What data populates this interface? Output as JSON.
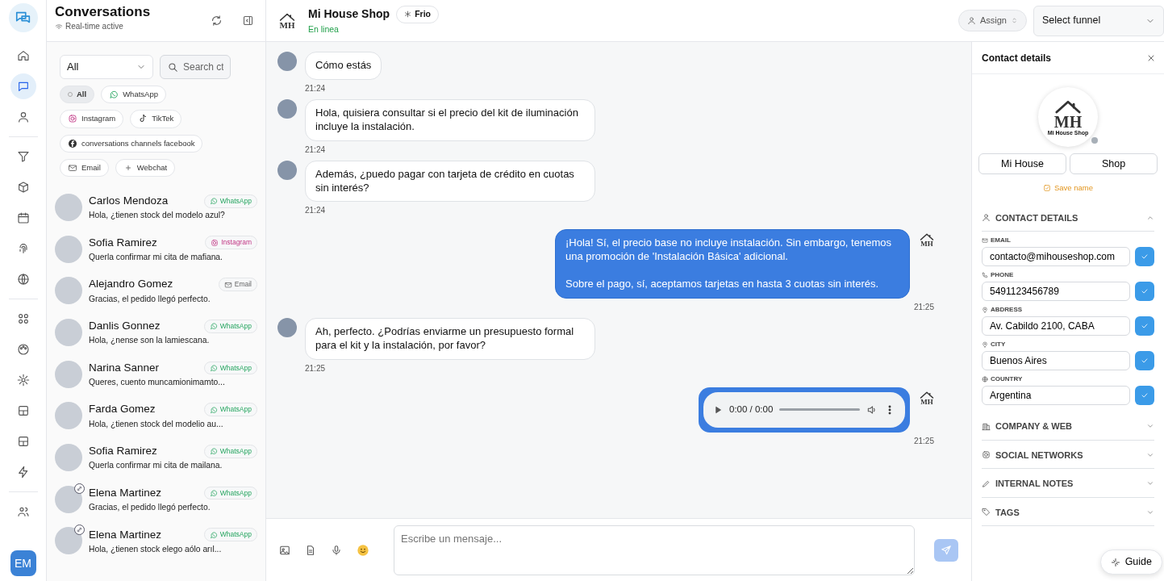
{
  "rail": {
    "groups": [
      [
        {
          "kind": "home",
          "selected": false
        },
        {
          "kind": "chat",
          "selected": true
        },
        {
          "kind": "user",
          "selected": false
        }
      ],
      [
        {
          "kind": "filter",
          "selected": false
        },
        {
          "kind": "box",
          "selected": false
        },
        {
          "kind": "calendar",
          "selected": false
        },
        {
          "kind": "fingerprint",
          "selected": false
        },
        {
          "kind": "globe",
          "selected": false
        }
      ],
      [
        {
          "kind": "apps",
          "selected": false
        },
        {
          "kind": "palette",
          "selected": false
        },
        {
          "kind": "gear",
          "selected": false
        },
        {
          "kind": "layout",
          "selected": false
        },
        {
          "kind": "layout",
          "selected": false
        },
        {
          "kind": "bolt",
          "selected": false
        }
      ],
      [
        {
          "kind": "users",
          "selected": false
        }
      ]
    ],
    "user_initials": "EM"
  },
  "conversations": {
    "title": "Conversations",
    "status": "Real-time active",
    "filter_value": "All",
    "search_placeholder": "Search ct",
    "channels": [
      {
        "kind": "all",
        "label": "All",
        "selected": true
      },
      {
        "kind": "whatsapp",
        "label": "WhatsApp",
        "selected": false
      },
      {
        "kind": "instagram",
        "label": "Instagram",
        "selected": false
      },
      {
        "kind": "tiktok",
        "label": "TikTek",
        "selected": false
      },
      {
        "kind": "facebook",
        "label": "conversations channels facebook",
        "selected": false
      },
      {
        "kind": "email",
        "label": "Email",
        "selected": false
      },
      {
        "kind": "webchat",
        "label": "Webchat",
        "selected": false
      }
    ],
    "items": [
      {
        "name": "Carlos Mendoza",
        "channel": {
          "kind": "whatsapp",
          "label": "WhatsApp"
        },
        "preview": "Hola, ¿tienen stock del modelo azul?",
        "badge": false
      },
      {
        "name": "Sofia Ramirez",
        "channel": {
          "kind": "instagram",
          "label": "Instagram"
        },
        "preview": "Querla confirmar mi cita de mafiana.",
        "badge": false
      },
      {
        "name": "Alejandro Gomez",
        "channel": {
          "kind": "email",
          "label": "Email"
        },
        "preview": "Gracias, el pedido llegó perfecto.",
        "badge": false
      },
      {
        "name": "Danlis Gonnez",
        "channel": {
          "kind": "whatsapp",
          "label": "WhatsApp"
        },
        "preview": "Hola, ¿nense son la lamiescana.",
        "badge": false
      },
      {
        "name": "Narina Sanner",
        "channel": {
          "kind": "whatsapp",
          "label": "WhatsApp"
        },
        "preview": "Queres, cuento muncamionimamto...",
        "badge": false
      },
      {
        "name": "Farda Gomez",
        "channel": {
          "kind": "whatsapp",
          "label": "WhatsApp"
        },
        "preview": "Hola, ¿tienen stock del modelio au...",
        "badge": false
      },
      {
        "name": "Sofia Ramirez",
        "channel": {
          "kind": "whatsapp",
          "label": "WhatsApp"
        },
        "preview": "Querla confirmar mi cita de mailana.",
        "badge": false
      },
      {
        "name": "Elena Martinez",
        "channel": {
          "kind": "whatsapp",
          "label": "WhatsApp"
        },
        "preview": "Gracias, el pedido llegó perfecto.",
        "badge": true
      },
      {
        "name": "Elena Martinez",
        "channel": {
          "kind": "whatsapp",
          "label": "WhatsApp"
        },
        "preview": "Hola, ¿tienen stock elego aólo arıl...",
        "badge": true
      }
    ]
  },
  "chat": {
    "header": {
      "logo_text": "MH",
      "name": "Mi House Shop",
      "tag": "Frio",
      "status": "En linea"
    },
    "assign_label": "Assign",
    "funnel_value": "Select funnel",
    "messages": [
      {
        "outgoing": false,
        "kind": "text",
        "paragraphs": [
          "Cómo estás"
        ],
        "time": "21:24"
      },
      {
        "outgoing": false,
        "kind": "text",
        "paragraphs": [
          "Hola, quisiera consultar si el precio del kit de iluminación incluye la instalación."
        ],
        "time": "21:24"
      },
      {
        "outgoing": false,
        "kind": "text",
        "paragraphs": [
          "Además, ¿puedo pagar con tarjeta de crédito en cuotas sin interés?"
        ],
        "time": "21:24"
      },
      {
        "outgoing": true,
        "kind": "text",
        "paragraphs": [
          "¡Hola! Sí, el precio base no incluye instalación. Sin embargo, tenemos una promoción de 'Instalación Básica' adicional.",
          "Sobre el pago, sí, aceptamos tarjetas en hasta 3 cuotas sin interés."
        ],
        "time": "21:25",
        "avatar_text": "MH"
      },
      {
        "outgoing": false,
        "kind": "text",
        "paragraphs": [
          "Ah, perfecto. ¿Podrías enviarme un presupuesto formal para el kit y la instalación, por favor?"
        ],
        "time": "21:25"
      },
      {
        "outgoing": true,
        "kind": "audio",
        "audio_time": "0:00 / 0:00",
        "time": "21:25",
        "avatar_text": "MH"
      }
    ],
    "composer": {
      "placeholder": "Escribe un mensaje...",
      "send_disabled": true
    }
  },
  "contact": {
    "title": "Contact details",
    "avatar": {
      "logo_text": "MH",
      "caption": "Mi House Shop",
      "online": false
    },
    "first_name": "Mi House",
    "last_name": "Shop",
    "save_label": "Save name",
    "sections": [
      {
        "kind": "contact",
        "title": "CONTACT DETAILS",
        "expanded": true,
        "fields": [
          {
            "kind": "email",
            "label": "EMAIL",
            "value": "contacto@mihouseshop.com"
          },
          {
            "kind": "phone",
            "label": "PHONE",
            "value": "5491123456789"
          },
          {
            "kind": "pin",
            "label": "ABDRESS",
            "value": "Av. Cabildo 2100, CABA"
          },
          {
            "kind": "pin",
            "label": "CITY",
            "value": "Buenos Aires"
          },
          {
            "kind": "globe",
            "label": "COUNTRY",
            "value": "Argentina"
          }
        ]
      },
      {
        "kind": "company",
        "title": "COMPANY & WEB",
        "expanded": false
      },
      {
        "kind": "social",
        "title": "SOCIAL NETWORKS",
        "expanded": false
      },
      {
        "kind": "notes",
        "title": "INTERNAL NOTES",
        "expanded": false
      },
      {
        "kind": "tags",
        "title": "TAGS",
        "expanded": false
      }
    ],
    "guide_label": "Guide"
  }
}
